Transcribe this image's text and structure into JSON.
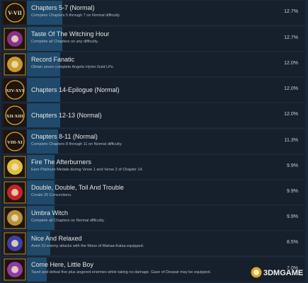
{
  "achievements": [
    {
      "title": "Chapters 5-7 (Normal)",
      "description": "Complete Chapters 5 through 7 on Normal difficulty.",
      "percent": "12.7%",
      "percent_value": 12.7,
      "icon": "roman-numeral-v-vii-icon",
      "icon_text": "V-VII",
      "accent": "#b8933c"
    },
    {
      "title": "Taste Of The Witching Hour",
      "description": "Complete all Chapters on any difficulty.",
      "percent": "12.7%",
      "percent_value": 12.7,
      "icon": "witch-portrait-icon",
      "icon_text": "",
      "accent": "#8a2f8e"
    },
    {
      "title": "Record Fanatic",
      "description": "Obtain seven complete Angelic Hymn Gold LPs.",
      "percent": "12.0%",
      "percent_value": 12.0,
      "icon": "gold-record-icon",
      "icon_text": "",
      "accent": "#c89a2e"
    },
    {
      "title": "Chapters 14-Epilogue (Normal)",
      "description": "",
      "percent": "12.0%",
      "percent_value": 12.0,
      "icon": "roman-numeral-xiv-xvi-icon",
      "icon_text": "XIV-XVI",
      "accent": "#b8933c"
    },
    {
      "title": "Chapters 12-13 (Normal)",
      "description": "",
      "percent": "12.0%",
      "percent_value": 12.0,
      "icon": "roman-numeral-xii-xiii-icon",
      "icon_text": "XII-XIII",
      "accent": "#b8933c"
    },
    {
      "title": "Chapters 8-11 (Normal)",
      "description": "Complete Chapters 8 through 11 on Normal difficulty.",
      "percent": "11.3%",
      "percent_value": 11.3,
      "icon": "roman-numeral-viii-xi-icon",
      "icon_text": "VIII-XI",
      "accent": "#b8933c"
    },
    {
      "title": "Fire The Afterburners",
      "description": "Earn Platinum Medals during Verse 1 and Verse 2 of Chapter 14.",
      "percent": "9.9%",
      "percent_value": 9.9,
      "icon": "afterburner-rocket-icon",
      "icon_text": "",
      "accent": "#e0c040"
    },
    {
      "title": "Double, Double, Toil And Trouble",
      "description": "Create 20 Concoctions.",
      "percent": "9.9%",
      "percent_value": 9.9,
      "icon": "concoction-potion-icon",
      "icon_text": "",
      "accent": "#c0262c"
    },
    {
      "title": "Umbra Witch",
      "description": "Complete all Chapters on Normal difficulty.",
      "percent": "9.9%",
      "percent_value": 9.9,
      "icon": "umbra-witch-emblem-icon",
      "icon_text": "",
      "accent": "#b8933c"
    },
    {
      "title": "Nice And Relaxed",
      "description": "Avert 10 enemy attacks with the Moon of Mahaa-Kalaa equipped.",
      "percent": "8.5%",
      "percent_value": 8.5,
      "icon": "moon-of-mahaa-kalaa-icon",
      "icon_text": "",
      "accent": "#3f3fa8"
    },
    {
      "title": "Come Here, Little Boy",
      "description": "Taunt and defeat five plus angered enemies while taking no damage. Gaze of Despair may be equipped.",
      "percent": "7.0%",
      "percent_value": 7.0,
      "icon": "gaze-of-despair-icon",
      "icon_text": "",
      "accent": "#8e3aa8"
    }
  ],
  "watermark": {
    "text": "3DMGAME",
    "icon": "3dmgame-logo-icon"
  }
}
